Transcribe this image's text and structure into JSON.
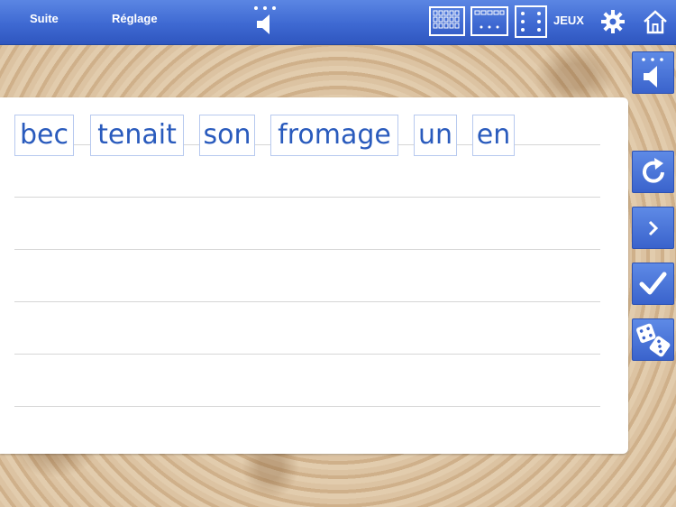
{
  "topbar": {
    "suite_label": "Suite",
    "reglage_label": "Réglage",
    "jeux_label": "JEUX"
  },
  "sentence_words": [
    "bec",
    "tenait",
    "son",
    "fromage",
    "un",
    "en"
  ],
  "icons": {
    "top_sound": "speaker-icon",
    "grid_large": "grid-many-icon",
    "grid_medium": "grid-few-icon",
    "grid_dots": "dice-dots-icon",
    "settings": "gear-icon",
    "home": "home-icon",
    "side_sound": "speaker-icon",
    "side_restart": "refresh-icon",
    "side_next": "chevron-right-icon",
    "side_check": "checkmark-icon",
    "side_dice": "dice-icon"
  },
  "colors": {
    "topbar": "#3e69d2",
    "word_text": "#2a5bbd",
    "word_border": "#b7c9ef",
    "side_button": "#4a73d8"
  }
}
